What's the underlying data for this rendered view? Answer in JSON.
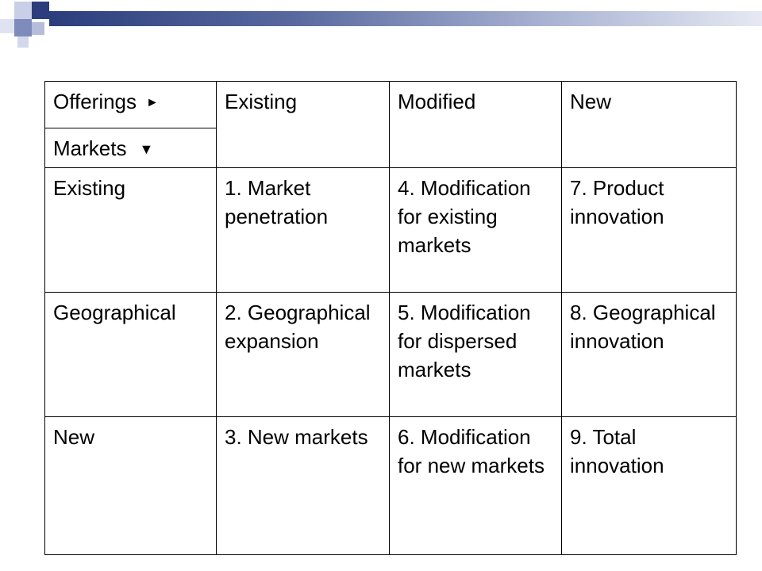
{
  "colors": {
    "header_text": "#1f3a6e",
    "row_label_text": "#7b1717",
    "body_text": "#000000",
    "accent_dark": "#2b3d7c",
    "accent_light": "#a9b3d2"
  },
  "header": {
    "offerings_label": "Offerings",
    "offerings_arrow": "►",
    "markets_label": "Markets",
    "markets_arrow": "▼",
    "columns": [
      "Existing",
      "Modified",
      "New"
    ]
  },
  "rows": [
    {
      "label": "Existing",
      "cells": [
        "1. Market penetration",
        "4. Modification for existing markets",
        "7. Product innovation"
      ]
    },
    {
      "label": "Geographical",
      "cells": [
        "2. Geographical expansion",
        "5. Modification for dispersed markets",
        "8. Geographical innovation"
      ]
    },
    {
      "label": "New",
      "cells": [
        "3. New markets",
        "6. Modification for new markets",
        "9. Total innovation"
      ]
    }
  ]
}
